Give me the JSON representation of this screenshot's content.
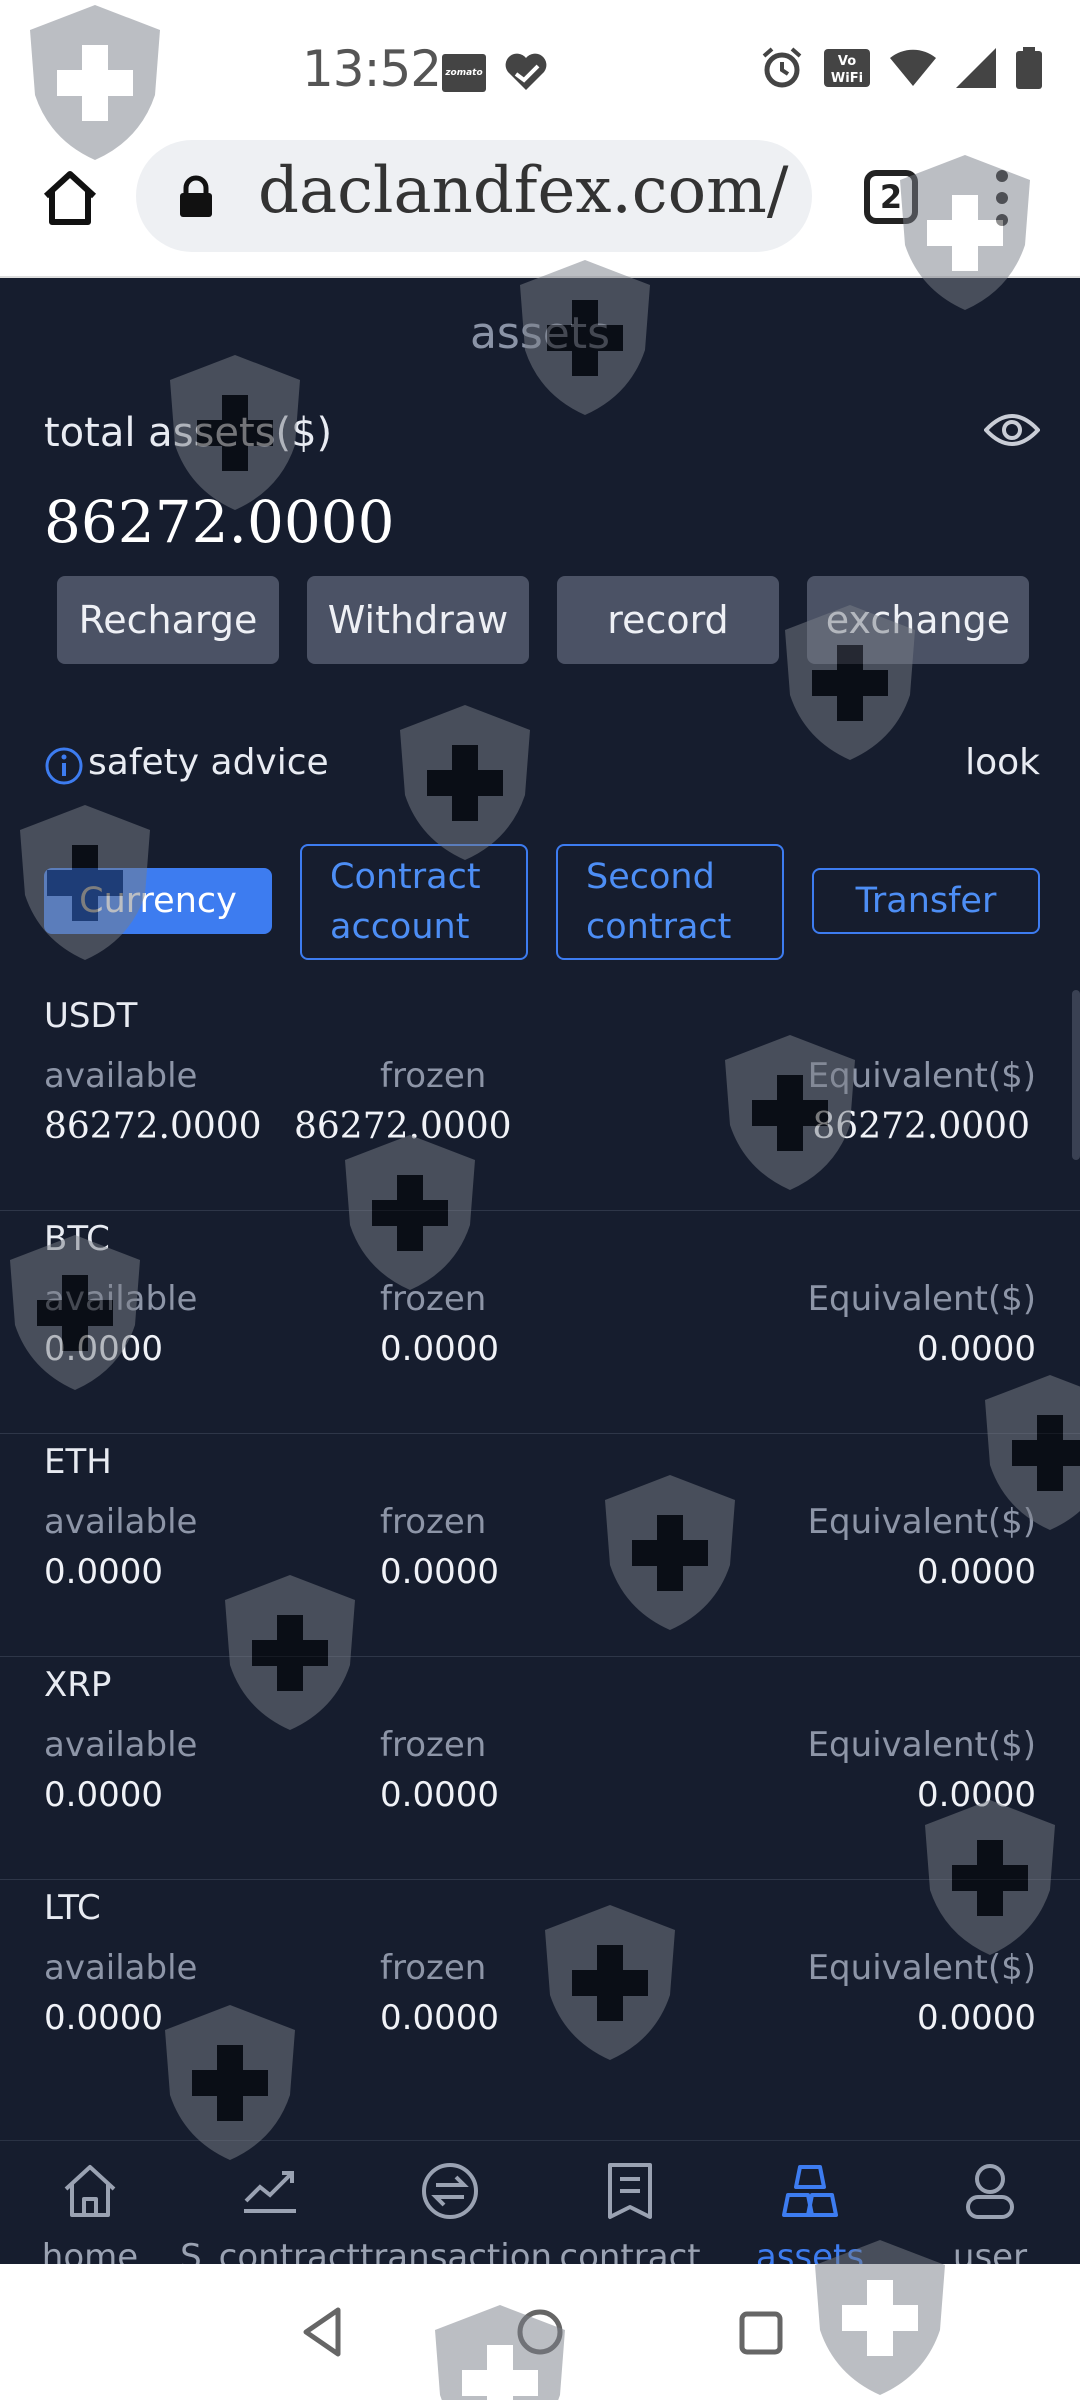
{
  "status_bar": {
    "time": "13:52",
    "notification_app": "zomato"
  },
  "browser": {
    "url": "daclandfex.com/",
    "tab_count": "2"
  },
  "page": {
    "title": "assets",
    "total_label": "total assets($)",
    "total_value": "86272.0000",
    "actions": [
      "Recharge",
      "Withdraw",
      "record",
      "exchange"
    ],
    "safety_advice": "safety advice",
    "look": "look",
    "tabs": [
      {
        "label": "Currency",
        "active": true
      },
      {
        "label": "Contract account",
        "active": false
      },
      {
        "label": "Second contract",
        "active": false
      },
      {
        "label": "Transfer",
        "active": false
      }
    ],
    "column_labels": {
      "available": "available",
      "frozen": "frozen",
      "equivalent": "Equivalent($)"
    },
    "assets": [
      {
        "name": "USDT",
        "available": "86272.0000",
        "frozen": "86272.0000",
        "equivalent": "86272.0000"
      },
      {
        "name": "BTC",
        "available": "0.0000",
        "frozen": "0.0000",
        "equivalent": "0.0000"
      },
      {
        "name": "ETH",
        "available": "0.0000",
        "frozen": "0.0000",
        "equivalent": "0.0000"
      },
      {
        "name": "XRP",
        "available": "0.0000",
        "frozen": "0.0000",
        "equivalent": "0.0000"
      },
      {
        "name": "LTC",
        "available": "0.0000",
        "frozen": "0.0000",
        "equivalent": "0.0000"
      }
    ]
  },
  "bottom_nav": [
    {
      "label": "home",
      "icon": "home-icon",
      "active": false
    },
    {
      "label": "S_contract",
      "icon": "chart-icon",
      "active": false
    },
    {
      "label": "transaction",
      "icon": "exchange-icon",
      "active": false
    },
    {
      "label": "contract",
      "icon": "document-icon",
      "active": false
    },
    {
      "label": "assets",
      "icon": "gold-bars-icon",
      "active": true
    },
    {
      "label": "user",
      "icon": "user-icon",
      "active": false
    }
  ],
  "colors": {
    "background": "#161d2e",
    "accent": "#3d7cf0",
    "button": "#4b5265"
  }
}
